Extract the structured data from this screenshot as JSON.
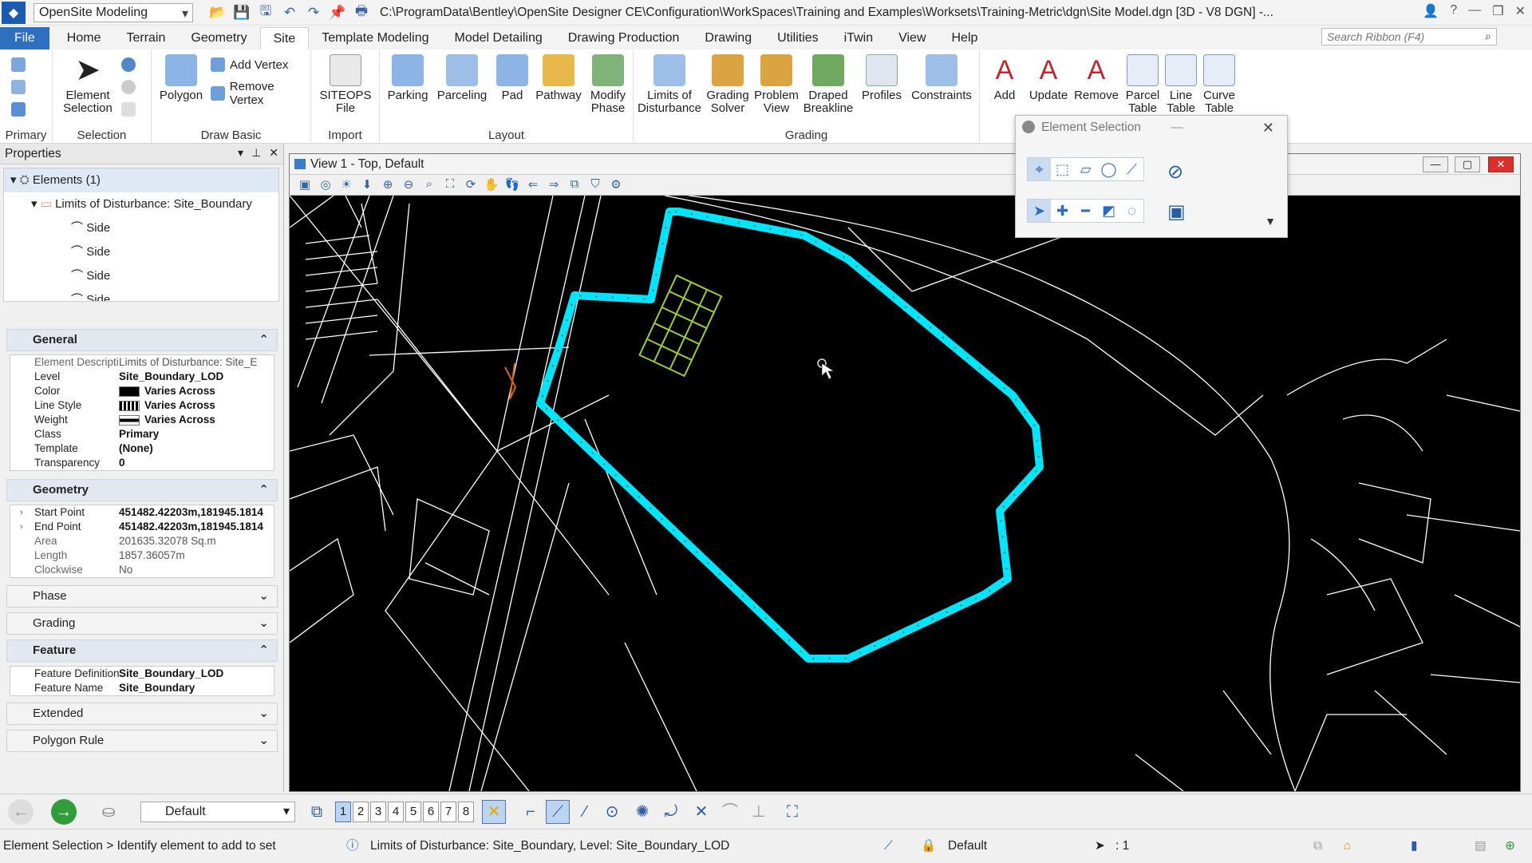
{
  "titlebar": {
    "workspace": "OpenSite Modeling",
    "document_path": "C:\\ProgramData\\Bentley\\OpenSite Designer CE\\Configuration\\WorkSpaces\\Training and Examples\\Worksets\\Training-Metric\\dgn\\Site Model.dgn [3D - V8 DGN] -..."
  },
  "menu": {
    "tabs": [
      "File",
      "Home",
      "Terrain",
      "Geometry",
      "Site",
      "Template Modeling",
      "Model Detailing",
      "Drawing Production",
      "Drawing",
      "Utilities",
      "iTwin",
      "View",
      "Help"
    ],
    "active": "Site",
    "search_placeholder": "Search Ribbon (F4)"
  },
  "ribbon": {
    "primary": {
      "label": "Primary"
    },
    "selection": {
      "label": "Selection",
      "element_selection": "Element Selection"
    },
    "draw_basic": {
      "label": "Draw Basic",
      "polygon": "Polygon",
      "add_vertex": "Add Vertex",
      "remove_vertex": "Remove Vertex"
    },
    "import": {
      "label": "Import",
      "siteops": "SITEOPS File"
    },
    "layout": {
      "label": "Layout",
      "parking": "Parking",
      "parceling": "Parceling",
      "pad": "Pad",
      "pathway": "Pathway",
      "modify_phase": "Modify Phase"
    },
    "grading": {
      "label": "Grading",
      "limits": "Limits of Disturbance",
      "solver": "Grading Solver",
      "problem": "Problem View",
      "draped": "Draped Breakline",
      "profiles": "Profiles",
      "constraints": "Constraints"
    },
    "annot": {
      "add": "Add",
      "update": "Update",
      "remove": "Remove",
      "parcel_table": "Parcel Table",
      "line_table": "Line Table",
      "curve_table": "Curve Table"
    }
  },
  "properties": {
    "title": "Properties",
    "tree": {
      "root": "Elements (1)",
      "child": "Limits of Disturbance: Site_Boundary",
      "sides": [
        "Side",
        "Side",
        "Side",
        "Side"
      ]
    },
    "general": {
      "title": "General",
      "rows": [
        {
          "k": "Element Descripti",
          "v": "Limits of Disturbance: Site_E"
        },
        {
          "k": "Level",
          "v": "Site_Boundary_LOD"
        },
        {
          "k": "Color",
          "v": "Varies Across"
        },
        {
          "k": "Line Style",
          "v": "Varies Across"
        },
        {
          "k": "Weight",
          "v": "Varies Across"
        },
        {
          "k": "Class",
          "v": "Primary"
        },
        {
          "k": "Template",
          "v": "(None)"
        },
        {
          "k": "Transparency",
          "v": "0"
        }
      ]
    },
    "geometry": {
      "title": "Geometry",
      "rows": [
        {
          "k": "Start Point",
          "v": "451482.42203m,181945.1814"
        },
        {
          "k": "End Point",
          "v": "451482.42203m,181945.1814"
        },
        {
          "k": "Area",
          "v": "201635.32078 Sq.m"
        },
        {
          "k": "Length",
          "v": "1857.36057m"
        },
        {
          "k": "Clockwise",
          "v": "No"
        }
      ]
    },
    "phase": {
      "title": "Phase"
    },
    "grading": {
      "title": "Grading"
    },
    "feature": {
      "title": "Feature",
      "rows": [
        {
          "k": "Feature Definition",
          "v": "Site_Boundary_LOD"
        },
        {
          "k": "Feature Name",
          "v": "Site_Boundary"
        }
      ]
    },
    "extended": {
      "title": "Extended"
    },
    "polygon_rule": {
      "title": "Polygon Rule"
    }
  },
  "view": {
    "title": "View 1 - Top, Default"
  },
  "element_selection": {
    "title": "Element Selection"
  },
  "bottom": {
    "model": "Default",
    "view_numbers": [
      "1",
      "2",
      "3",
      "4",
      "5",
      "6",
      "7",
      "8"
    ],
    "active_view": "1"
  },
  "status": {
    "prompt": "Element Selection > Identify element to add to set",
    "message": "Limits of Disturbance: Site_Boundary, Level: Site_Boundary_LOD",
    "active_model": "Default",
    "selection_count": ": 1"
  },
  "colors": {
    "boundary": "#00e5ff",
    "accent": "#2f6fc0",
    "pad": "#9ccc3c"
  }
}
